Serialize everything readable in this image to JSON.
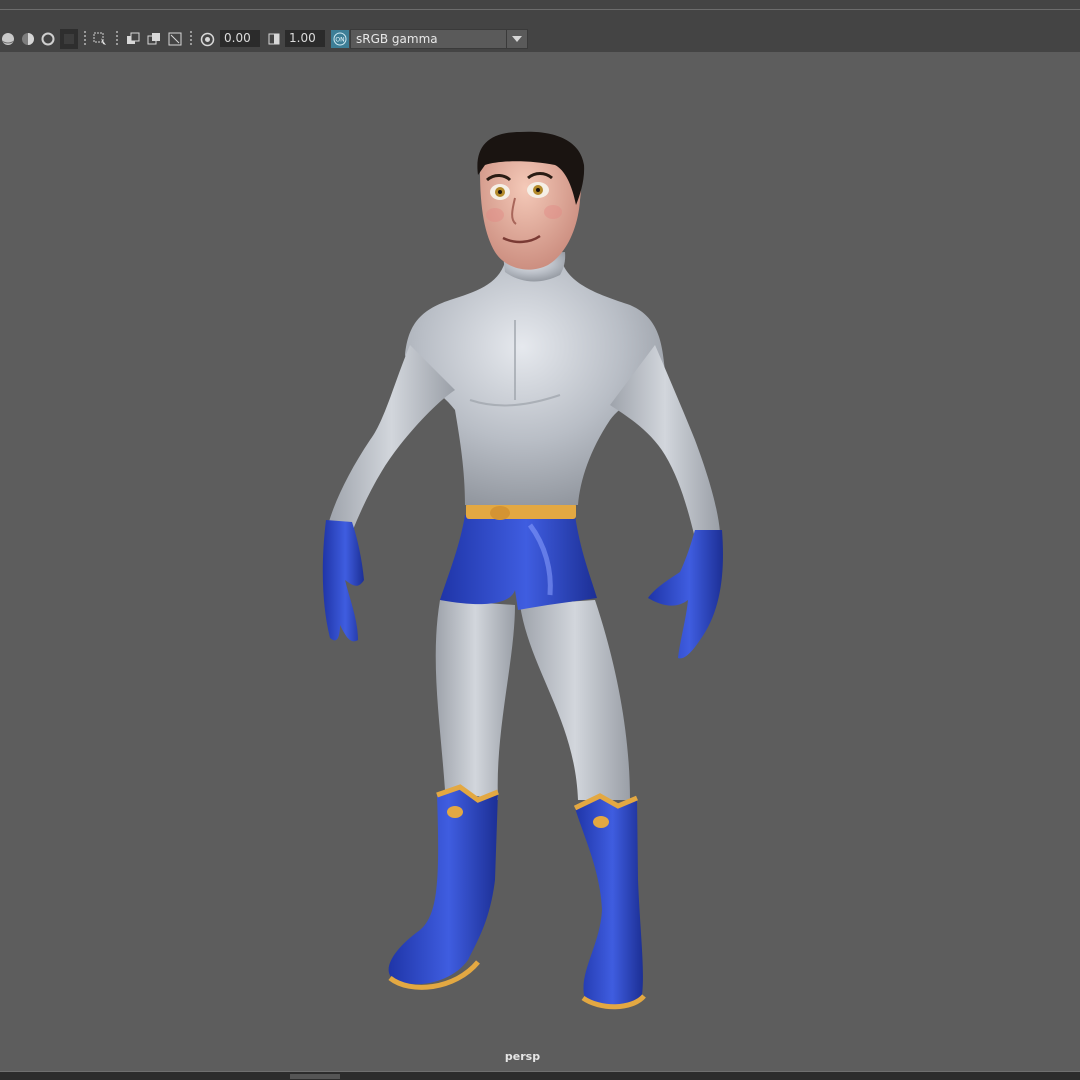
{
  "toolbar": {
    "exposure_value": "0.00",
    "gamma_value": "1.00",
    "colormgmt_badge": "ON",
    "color_space": "sRGB gamma",
    "icons": [
      "sphere-shaded-icon",
      "sphere-half-icon",
      "sphere-wire-icon",
      "grid-toggle-icon",
      "select-cage-icon",
      "isolate-select-icon",
      "xray-icon",
      "xray-joints-icon",
      "frame-icon",
      "exposure-icon",
      "gamma-icon",
      "color-mgmt-icon",
      "dropdown-arrow-icon"
    ]
  },
  "viewport": {
    "camera_name": "persp",
    "background_color": "#5d5d5d"
  },
  "character": {
    "suit_color": "#b7bcc4",
    "accent_color": "#2f48c9",
    "trim_color": "#e0a53e",
    "skin_color": "#e8b0a0",
    "hair_color": "#1a1411"
  }
}
